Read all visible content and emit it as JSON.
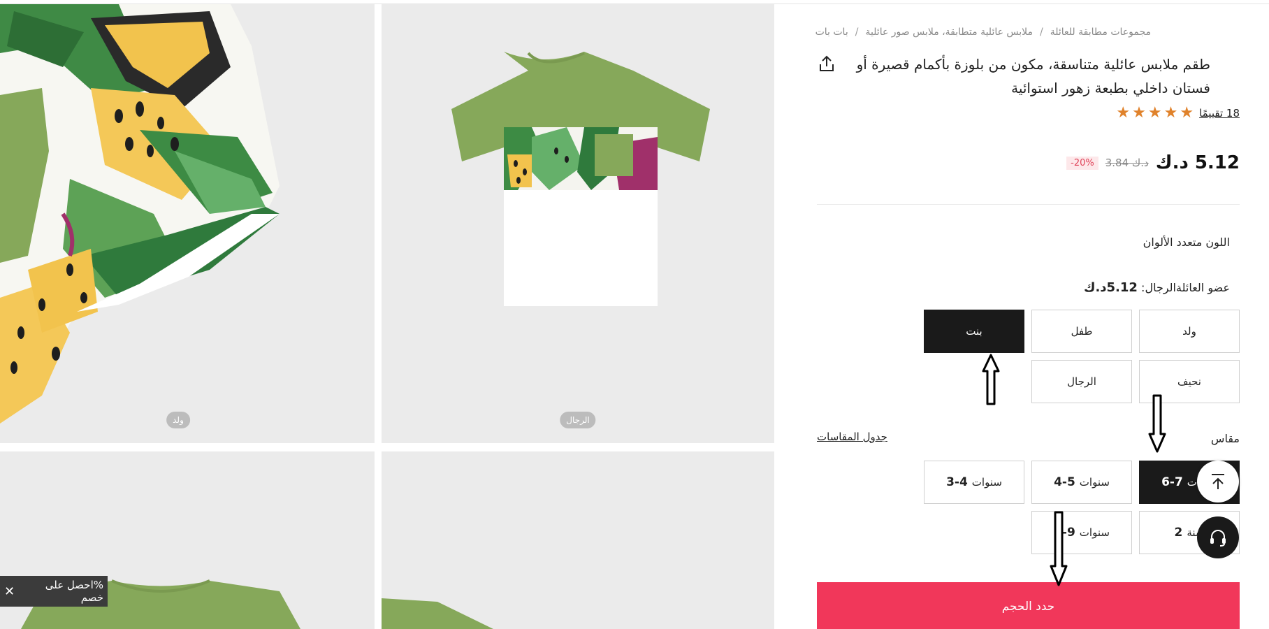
{
  "breadcrumb": {
    "items": [
      "مجموعات مطابقة للعائلة",
      "ملابس عائلية متطابقة، ملابس صور عائلية",
      "بات بات"
    ],
    "separator": "/"
  },
  "product": {
    "title": "طقم ملابس عائلية متناسقة، مكون من بلوزة بأكمام قصيرة أو فستان داخلي بطبعة زهور استوائية",
    "rating_stars": 5,
    "reviews_label": "18 تقييمًا",
    "price": "5.12 د.ك",
    "old_price": "د.ك 3.84",
    "discount": "-20%"
  },
  "gallery": {
    "tag_boy": "ولد",
    "tag_men": "الرجال"
  },
  "color": {
    "label": "اللون متعدد الألوان"
  },
  "member": {
    "label_prefix": "عضو العائلة",
    "label_selected": "الرجال:",
    "label_price": "5.12د.ك",
    "options": [
      "ولد",
      "طفل",
      "بنت",
      "نحيف",
      "الرجال"
    ],
    "selected": "بنت"
  },
  "size": {
    "label": "مقاس",
    "chart_link": "جدول المقاسات",
    "options": [
      {
        "num": "6-7",
        "unit": "سنوات"
      },
      {
        "num": "4-5",
        "unit": "سنوات"
      },
      {
        "num": "3-4",
        "unit": "سنوات"
      },
      {
        "num": "2",
        "unit": "سنة"
      },
      {
        "num": "8-9",
        "unit": "سنوات"
      }
    ],
    "selected": "6-7"
  },
  "cta": {
    "label": "حدد الحجم"
  },
  "promo": {
    "text": "%احصل على خصم",
    "close": "✕"
  },
  "icons": {
    "share": "share-icon",
    "back_to_top": "arrow-up-icon",
    "support": "headset-icon"
  },
  "colors": {
    "accent": "#f1375a",
    "selected": "#1a1a1a",
    "star": "#e0822b",
    "discount": "#e0445a",
    "shirt_green": "#86a85a"
  }
}
